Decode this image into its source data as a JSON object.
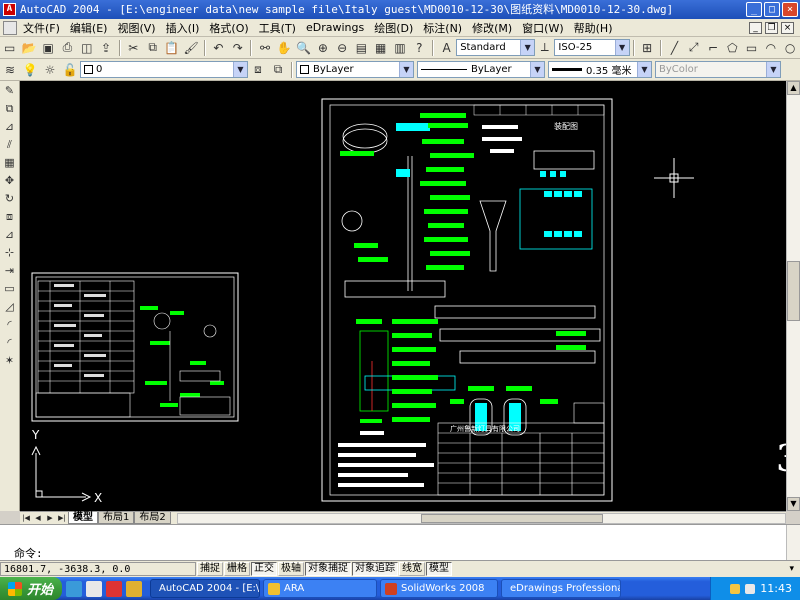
{
  "title_bar": {
    "app_icon": "autocad-icon",
    "text": "AutoCAD 2004 - [E:\\engineer data\\new sample file\\Italy guest\\MD0010-12-30\\图纸资料\\MD0010-12-30.dwg]"
  },
  "menu": [
    "文件(F)",
    "编辑(E)",
    "视图(V)",
    "插入(I)",
    "格式(O)",
    "工具(T)",
    "eDrawings",
    "绘图(D)",
    "标注(N)",
    "修改(M)",
    "窗口(W)",
    "帮助(H)"
  ],
  "toolbar": {
    "text_style": "Standard",
    "dim_style": "ISO-25"
  },
  "properties": {
    "layer": "0",
    "color": "ByLayer",
    "linetype": "ByLayer",
    "lineweight": "0.35 毫米",
    "plotstyle": "ByColor"
  },
  "canvas": {
    "background": "#000000",
    "accent_green": "#00ff00",
    "accent_cyan": "#00ffff",
    "ucs_x": "X",
    "ucs_y": "Y",
    "sheet_text_1": "装配图",
    "sheet_company": "广州鲁新灯具有限公司",
    "edge_glyph": "3"
  },
  "layout_tabs": [
    "模型",
    "布局1",
    "布局2"
  ],
  "active_tab": "模型",
  "command": {
    "prompt": "命令:"
  },
  "status": {
    "coordinates": "16801.7, -3638.3, 0.0",
    "buttons": [
      "捕捉",
      "栅格",
      "正交",
      "极轴",
      "对象捕捉",
      "对象追踪",
      "线宽",
      "模型"
    ]
  },
  "taskbar": {
    "start": "开始",
    "tasks": [
      {
        "label": "AutoCAD 2004 - [E:\\...",
        "color": "#d02020"
      },
      {
        "label": "ARA",
        "color": "#f0c030"
      },
      {
        "label": "SolidWorks 2008",
        "color": "#d04020"
      },
      {
        "label": "eDrawings Professional",
        "color": "#30a040"
      }
    ],
    "clock": "11:43"
  }
}
